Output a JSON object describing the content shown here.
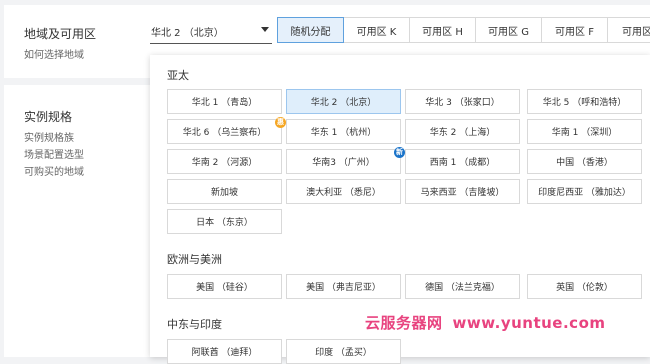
{
  "region_section": {
    "title": "地域及可用区",
    "help_link": "如何选择地域",
    "selected_region": "华北 2 （北京）"
  },
  "zones": [
    "随机分配",
    "可用区 K",
    "可用区 H",
    "可用区 G",
    "可用区 F",
    "可用区"
  ],
  "active_zone": "随机分配",
  "spec_section": {
    "title": "实例规格",
    "links": [
      "实例规格族",
      "场景配置选型",
      "可购买的地域"
    ]
  },
  "groups": [
    {
      "title": "亚太",
      "items": [
        {
          "label": "华北 1 （青岛）"
        },
        {
          "label": "华北 2 （北京）",
          "selected": true
        },
        {
          "label": "华北 3 （张家口）"
        },
        {
          "label": "华北 5 （呼和浩特）"
        },
        {
          "label": "华北 6 （乌兰察布）",
          "badge": "惠",
          "badge_color": "#f5a623"
        },
        {
          "label": "华东 1 （杭州）"
        },
        {
          "label": "华东 2 （上海）"
        },
        {
          "label": "华南 1 （深圳）"
        },
        {
          "label": "华南 2 （河源）"
        },
        {
          "label": "华南3 （广州）",
          "badge": "新",
          "badge_color": "#1a73c9"
        },
        {
          "label": "西南 1 （成都）"
        },
        {
          "label": "中国 （香港）"
        },
        {
          "label": "新加坡"
        },
        {
          "label": "澳大利亚 （悉尼）"
        },
        {
          "label": "马来西亚 （吉隆坡）"
        },
        {
          "label": "印度尼西亚 （雅加达）"
        },
        {
          "label": "日本 （东京）"
        }
      ]
    },
    {
      "title": "欧洲与美洲",
      "items": [
        {
          "label": "美国 （硅谷）"
        },
        {
          "label": "美国 （弗吉尼亚）"
        },
        {
          "label": "德国 （法兰克福）"
        },
        {
          "label": "英国 （伦敦）"
        }
      ]
    },
    {
      "title": "中东与印度",
      "items": [
        {
          "label": "阿联酋 （迪拜）"
        },
        {
          "label": "印度 （孟买）"
        }
      ]
    }
  ],
  "watermark": {
    "cn": "云服务器网",
    "en": "www.yuntue.com"
  }
}
